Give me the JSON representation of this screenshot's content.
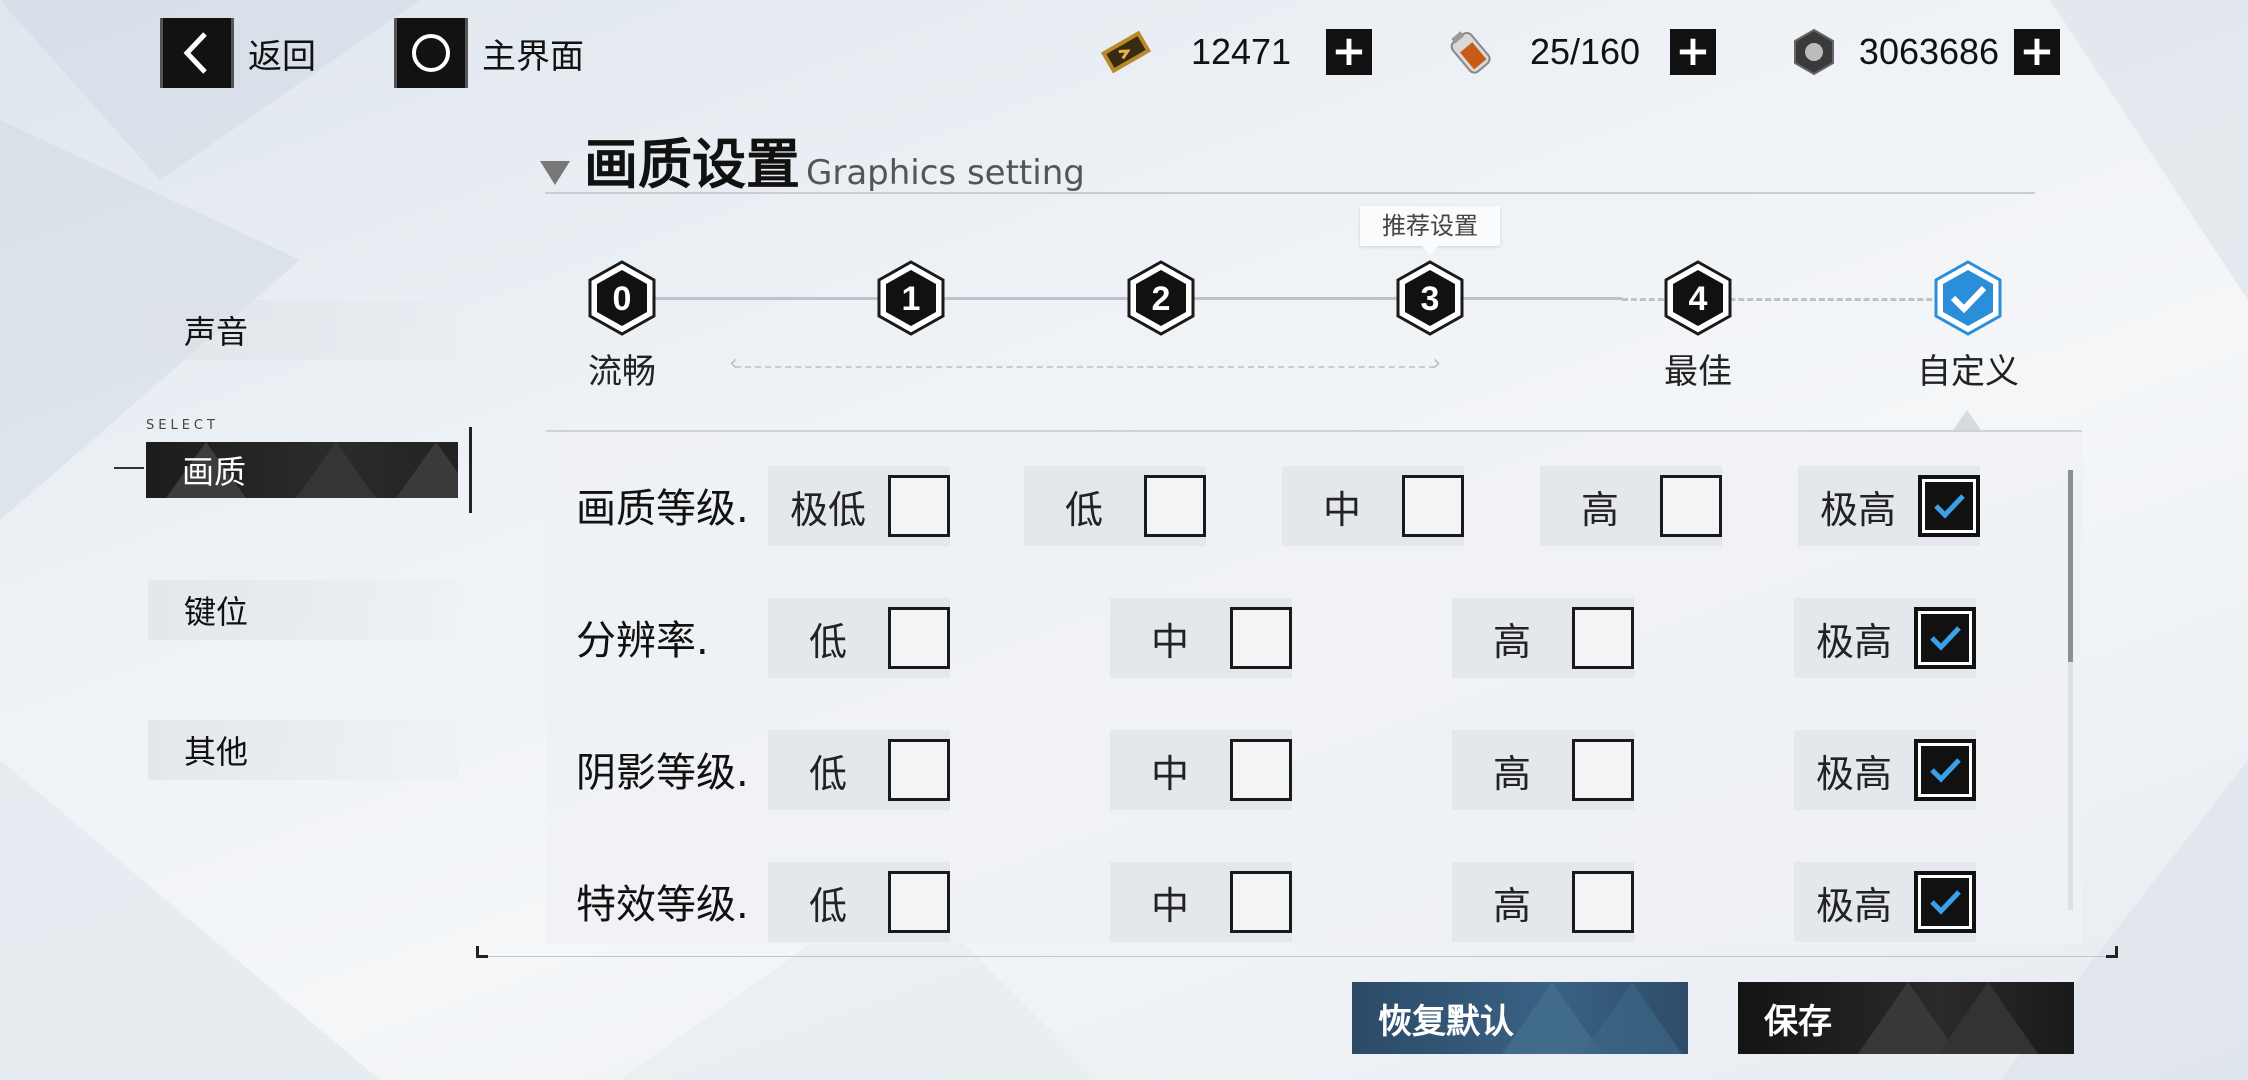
{
  "topbar": {
    "back_label": "返回",
    "home_label": "主界面",
    "resources": [
      {
        "icon": "ticket-icon",
        "value": "12471"
      },
      {
        "icon": "battery-icon",
        "value": "25/160"
      },
      {
        "icon": "gear-nut-icon",
        "value": "3063686"
      }
    ]
  },
  "header": {
    "title_zh": "画质设置",
    "title_en": "Graphics setting"
  },
  "presets": {
    "tooltip": "推荐设置",
    "items": [
      {
        "num": "0",
        "label": "流畅"
      },
      {
        "num": "1",
        "label": ""
      },
      {
        "num": "2",
        "label": ""
      },
      {
        "num": "3",
        "label": ""
      },
      {
        "num": "4",
        "label": "最佳"
      },
      {
        "num": "",
        "label": "自定义",
        "selected": true
      }
    ]
  },
  "sidebar": {
    "select_tag": "SELECT",
    "items": [
      {
        "label": "声音"
      },
      {
        "label": "画质",
        "selected": true
      },
      {
        "label": "键位"
      },
      {
        "label": "其他"
      }
    ]
  },
  "settings": [
    {
      "label": "画质等级.",
      "options": [
        "极低",
        "低",
        "中",
        "高",
        "极高"
      ],
      "checked": [
        false,
        false,
        false,
        false,
        true
      ]
    },
    {
      "label": "分辨率.",
      "options": [
        "低",
        "中",
        "高",
        "极高"
      ],
      "checked": [
        false,
        false,
        false,
        true
      ]
    },
    {
      "label": "阴影等级.",
      "options": [
        "低",
        "中",
        "高",
        "极高"
      ],
      "checked": [
        false,
        false,
        false,
        true
      ]
    },
    {
      "label": "特效等级.",
      "options": [
        "低",
        "中",
        "高",
        "极高"
      ],
      "checked": [
        false,
        false,
        false,
        true
      ]
    }
  ],
  "buttons": {
    "reset_label": "恢复默认",
    "save_label": "保存"
  },
  "colors": {
    "accent_blue": "#2a8fd8",
    "check_blue": "#3aa0e8",
    "reset_button": "#2f5677"
  }
}
